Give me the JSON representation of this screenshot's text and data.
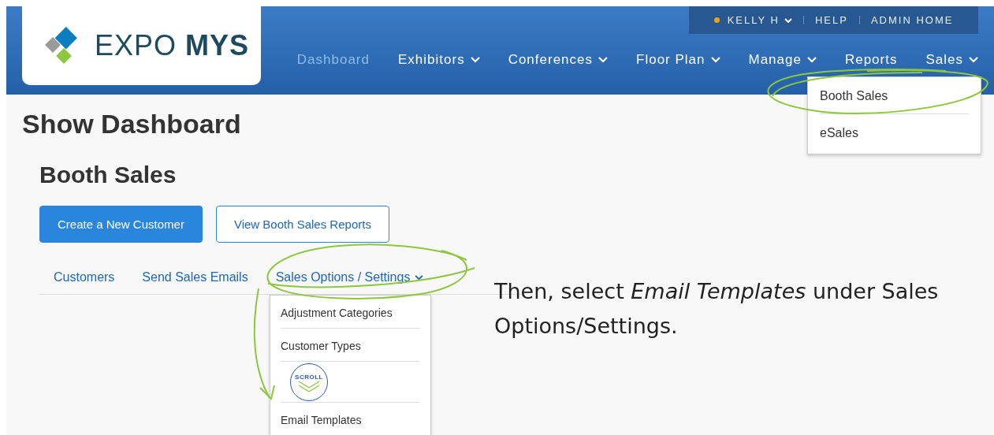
{
  "logo": {
    "word_light": "EXPO",
    "word_bold": "MYS"
  },
  "top_bar": {
    "user": {
      "label": "KELLY H",
      "color": "#e8a317"
    },
    "links": [
      "HELP",
      "ADMIN HOME"
    ]
  },
  "nav": [
    {
      "label": "Dashboard",
      "selected": true,
      "dropdown": false
    },
    {
      "label": "Exhibitors",
      "selected": false,
      "dropdown": true
    },
    {
      "label": "Conferences",
      "selected": false,
      "dropdown": true
    },
    {
      "label": "Floor Plan",
      "selected": false,
      "dropdown": true
    },
    {
      "label": "Manage",
      "selected": false,
      "dropdown": true
    },
    {
      "label": "Reports",
      "selected": false,
      "dropdown": false
    },
    {
      "label": "Sales",
      "selected": false,
      "dropdown": true
    }
  ],
  "sales_menu": [
    "Booth Sales",
    "eSales"
  ],
  "page_title": "Show Dashboard",
  "section_title": "Booth Sales",
  "buttons": [
    {
      "label": "Create a New Customer",
      "kind": "primary"
    },
    {
      "label": "View Booth Sales Reports",
      "kind": "outline"
    }
  ],
  "tabs": [
    {
      "label": "Customers",
      "dropdown": false
    },
    {
      "label": "Send Sales Emails",
      "dropdown": false
    },
    {
      "label": "Sales Options / Settings",
      "dropdown": true
    }
  ],
  "options_menu": [
    {
      "kind": "item",
      "label": "Adjustment Categories"
    },
    {
      "kind": "item",
      "label": "Customer Types"
    },
    {
      "kind": "scroll",
      "label": "SCROLL"
    },
    {
      "kind": "item",
      "label": "Email Templates"
    }
  ],
  "instruction": "Then, select *Email Templates* under Sales Options/Settings."
}
